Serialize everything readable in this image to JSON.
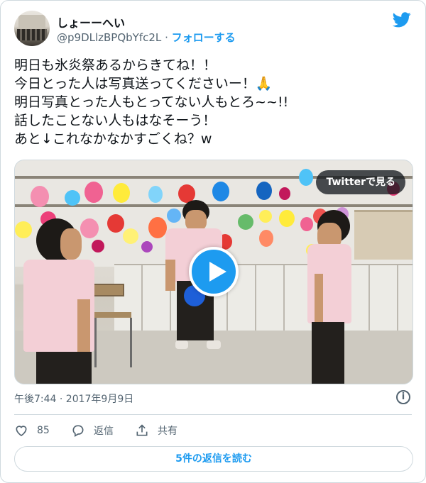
{
  "user": {
    "display_name": "しょーーへい",
    "handle": "@p9DLlzBPQbYfc2L",
    "separator": "·",
    "follow_label": "フォローする"
  },
  "tweet": {
    "lines": [
      "明日も氷炎祭あるからきてね！！",
      "今日とった人は写真送ってくださいー！🙏",
      "明日写真とった人もとってない人もとろ~~!!",
      "話したことない人もはなそーう！",
      "あと↓これなかなかすごくね？w"
    ]
  },
  "media": {
    "watch_label": "Twitterで見る"
  },
  "meta": {
    "timestamp": "午後7:44 · 2017年9月9日"
  },
  "actions": {
    "like_count": "85",
    "reply_label": "返信",
    "share_label": "共有"
  },
  "replies_button": "5件の返信を読む",
  "colors": {
    "accent": "#1d9bf0",
    "text": "#0f1419",
    "secondary": "#536471",
    "border": "#cfd9de"
  },
  "icons": [
    "twitter-bird-icon",
    "play-icon",
    "info-icon",
    "heart-icon",
    "reply-bubble-icon",
    "share-icon"
  ]
}
